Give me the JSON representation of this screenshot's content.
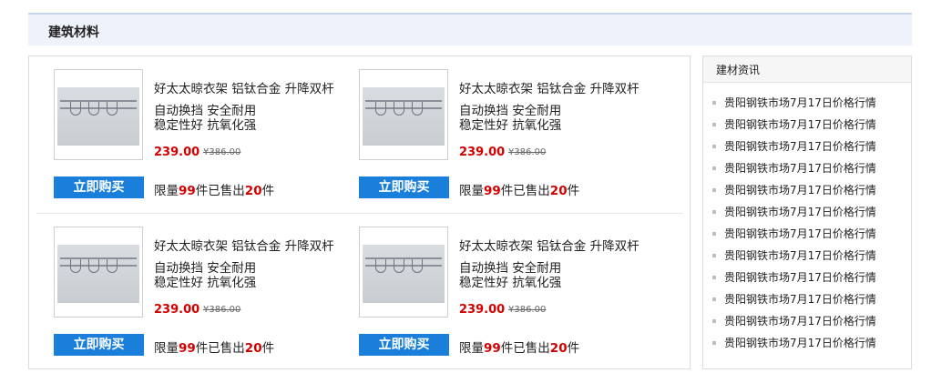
{
  "header": {
    "title": "建筑材料"
  },
  "products": [
    {
      "title": "好太太晾衣架 铝钛合金 升降双杆",
      "desc1": "自动换挡 安全耐用",
      "desc2": "稳定性好 抗氧化强",
      "price": "239.00",
      "old_price": "¥386.00",
      "buy_label": "立即购买",
      "limit_prefix": "限量",
      "limit_qty": "99",
      "limit_mid": "件已售出",
      "sold_qty": "20",
      "limit_suffix": "件"
    },
    {
      "title": "好太太晾衣架 铝钛合金 升降双杆",
      "desc1": "自动换挡 安全耐用",
      "desc2": "稳定性好 抗氧化强",
      "price": "239.00",
      "old_price": "¥386.00",
      "buy_label": "立即购买",
      "limit_prefix": "限量",
      "limit_qty": "99",
      "limit_mid": "件已售出",
      "sold_qty": "20",
      "limit_suffix": "件"
    },
    {
      "title": "好太太晾衣架 铝钛合金 升降双杆",
      "desc1": "自动换挡 安全耐用",
      "desc2": "稳定性好 抗氧化强",
      "price": "239.00",
      "old_price": "¥386.00",
      "buy_label": "立即购买",
      "limit_prefix": "限量",
      "limit_qty": "99",
      "limit_mid": "件已售出",
      "sold_qty": "20",
      "limit_suffix": "件"
    },
    {
      "title": "好太太晾衣架 铝钛合金 升降双杆",
      "desc1": "自动换挡 安全耐用",
      "desc2": "稳定性好 抗氧化强",
      "price": "239.00",
      "old_price": "¥386.00",
      "buy_label": "立即购买",
      "limit_prefix": "限量",
      "limit_qty": "99",
      "limit_mid": "件已售出",
      "sold_qty": "20",
      "limit_suffix": "件"
    }
  ],
  "sidebar": {
    "title": "建材资讯",
    "items": [
      "贵阳钢铁市场7月17日价格行情",
      "贵阳钢铁市场7月17日价格行情",
      "贵阳钢铁市场7月17日价格行情",
      "贵阳钢铁市场7月17日价格行情",
      "贵阳钢铁市场7月17日价格行情",
      "贵阳钢铁市场7月17日价格行情",
      "贵阳钢铁市场7月17日价格行情",
      "贵阳钢铁市场7月17日价格行情",
      "贵阳钢铁市场7月17日价格行情",
      "贵阳钢铁市场7月17日价格行情",
      "贵阳钢铁市场7月17日价格行情",
      "贵阳钢铁市场7月17日价格行情"
    ]
  },
  "colors": {
    "accent": "#1a7fdb",
    "price": "#d40000",
    "header_bg": "#eef2fa"
  }
}
